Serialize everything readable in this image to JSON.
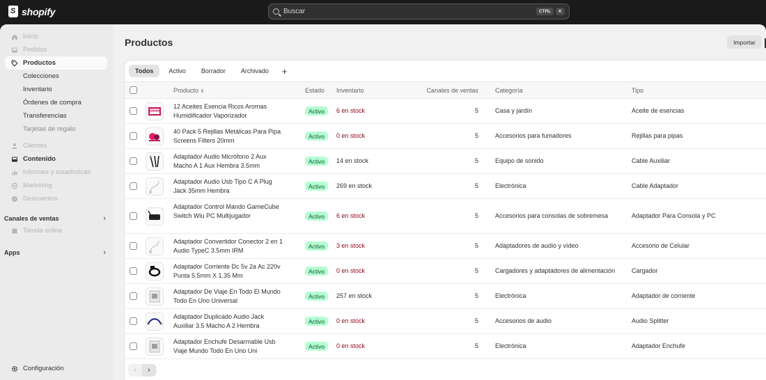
{
  "brand": {
    "name": "shopify"
  },
  "search": {
    "placeholder": "Buscar",
    "shortcut_mod": "CTRL",
    "shortcut_key": "K"
  },
  "sidebar": {
    "items": [
      {
        "label": "Inicio",
        "icon": "home-icon",
        "state": "dim"
      },
      {
        "label": "Pedidos",
        "icon": "inbox-icon",
        "state": "dim"
      },
      {
        "label": "Productos",
        "icon": "tag-icon",
        "state": "active"
      },
      {
        "label": "Colecciones",
        "state": "sub"
      },
      {
        "label": "Inventario",
        "state": "sub"
      },
      {
        "label": "Órdenes de compra",
        "state": "sub"
      },
      {
        "label": "Transferencias",
        "state": "sub"
      },
      {
        "label": "Tarjetas de regalo",
        "state": "sub-dim"
      },
      {
        "label": "Clientes",
        "icon": "person-icon",
        "state": "dim"
      },
      {
        "label": "Contenido",
        "icon": "content-icon",
        "state": "bold"
      },
      {
        "label": "Informes y estadísticas",
        "icon": "chart-icon",
        "state": "dim"
      },
      {
        "label": "Marketing",
        "icon": "target-icon",
        "state": "dim"
      },
      {
        "label": "Descuentos",
        "icon": "discount-icon",
        "state": "dim"
      }
    ],
    "sales_channels": {
      "label": "Canales de ventas",
      "items": [
        {
          "label": "Tienda online",
          "icon": "store-icon"
        }
      ]
    },
    "apps": {
      "label": "Apps"
    },
    "settings": {
      "label": "Configuración",
      "icon": "gear-icon"
    }
  },
  "page": {
    "title": "Productos",
    "import_label": "Importar"
  },
  "tabs": [
    {
      "label": "Todos",
      "selected": true
    },
    {
      "label": "Activo"
    },
    {
      "label": "Borrador"
    },
    {
      "label": "Archivado"
    }
  ],
  "tab_add": "+",
  "columns": {
    "product": "Producto",
    "status": "Estado",
    "inventory": "Inventario",
    "channels": "Canales de ventas",
    "category": "Categoría",
    "type": "Tipo"
  },
  "products": [
    {
      "name": "12 Aceites Esencia Ricos Aromas Humidificador Vaporizador",
      "status": "Activo",
      "inventory": "6 en stock",
      "low": true,
      "channels": "5",
      "category": "Casa y jardín",
      "type": "Aceite de esencias",
      "thumb": "oil-box"
    },
    {
      "name": "40 Pack 5 Rejillas Metálicas Para Pipa Screens Filters 20mm",
      "status": "Activo",
      "inventory": "0 en stock",
      "low": true,
      "channels": "5",
      "category": "Accesorios para fumadores",
      "type": "Rejillas para pipas",
      "thumb": "screens"
    },
    {
      "name": "Adaptador Audio Micrófono 2 Aux Macho A 1 Aux Hembra 3.5mm",
      "status": "Activo",
      "inventory": "14 en stock",
      "low": false,
      "channels": "5",
      "category": "Equipo de sonido",
      "type": "Cable Auxiliar",
      "thumb": "cables"
    },
    {
      "name": "Adaptador Audio Usb Tipo C A Plug Jack 35mm Hembra",
      "status": "Activo",
      "inventory": "269 en stock",
      "low": false,
      "channels": "5",
      "category": "Electrónica",
      "type": "Cable Adaptador",
      "thumb": "white-cable"
    },
    {
      "name": "Adaptador Control Mando GameCube Switch Wiu PC Multijugador",
      "status": "Activo",
      "inventory": "6 en stock",
      "low": true,
      "channels": "5",
      "category": "Accesorios para consolas de sobremesa",
      "type": "Adaptador Para Consola y PC",
      "thumb": "black-device"
    },
    {
      "name": "Adaptador Convertidor Conector 2 en 1 Audio TypeC 3.5mm IRM",
      "status": "Activo",
      "inventory": "3 en stock",
      "low": true,
      "channels": "5",
      "category": "Adaptadores de audio y vídeo",
      "type": "Accesorio de Celular",
      "thumb": "white-cable"
    },
    {
      "name": "Adaptador Corriente Dc 5v 2a Ac 220v Punta 5.5mm X 1.35 Mm",
      "status": "Activo",
      "inventory": "0 en stock",
      "low": true,
      "channels": "5",
      "category": "Cargadores y adaptadores de alimentación",
      "type": "Cargador",
      "thumb": "black-coil"
    },
    {
      "name": "Adaptador De Viaje En Todo El Mundo Todo En Uno Universal",
      "status": "Activo",
      "inventory": "257 en stock",
      "low": false,
      "channels": "5",
      "category": "Electrónica",
      "type": "Adaptador de corriente",
      "thumb": "plug-box"
    },
    {
      "name": "Adaptador Duplicado Audio Jack Auxiliar 3.5 Macho A 2 Hembra",
      "status": "Activo",
      "inventory": "0 en stock",
      "low": true,
      "channels": "5",
      "category": "Accesorios de audio",
      "type": "Audio Splitter",
      "thumb": "splitter"
    },
    {
      "name": "Adaptador Enchufe Desarmable Usb Viaje Mundo Todo En Uno Uni",
      "status": "Activo",
      "inventory": "0 en stock",
      "low": true,
      "channels": "5",
      "category": "Electrónica",
      "type": "Adaptador Enchufe",
      "thumb": "plug-box"
    }
  ],
  "pager": {
    "prev": "‹",
    "next": "›"
  }
}
